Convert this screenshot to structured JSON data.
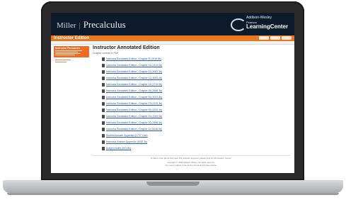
{
  "header": {
    "title_main": "Miller",
    "title_sub": "Precalculus",
    "logo_top": "Addison-Wesley",
    "logo_mid": "Pearson",
    "logo_main": "LearningCenter"
  },
  "band": {
    "title": "Instructor Edition"
  },
  "sidebar": {
    "heading": "Instructor Resources"
  },
  "main": {
    "title": "Instructor Annotated Edition",
    "subtitle": "Chapter content in PDF",
    "items": [
      {
        "label": "Instructor Annotated Edition - Chapter R (1919.5k)"
      },
      {
        "label": "Instructor Annotated Edition - Chapter 01 (2419.0k)"
      },
      {
        "label": "Instructor Annotated Edition - Chapter 02 (3087.3k)"
      },
      {
        "label": "Instructor Annotated Edition - Chapter 03 (3092.0k)"
      },
      {
        "label": "Instructor Annotated Edition - Chapter 04 (2719.9k)"
      },
      {
        "label": "Instructor Annotated Edition - Chapter 05 (2668.3k)"
      },
      {
        "label": "Instructor Annotated Edition - Chapter 06 (3037.8k)"
      },
      {
        "label": "Instructor Annotated Edition - Chapter 07 (2133.3k)"
      },
      {
        "label": "Instructor Annotated Edition - Chapter 08 (4243.3k)"
      },
      {
        "label": "Instructor Annotated Edition - Chapter 09 (2040.0k)"
      },
      {
        "label": "Instructor Annotated Edition - Chapter 10 (2696.4k)"
      },
      {
        "label": "Instructor Annotated Edition - Chapter 11 (3046.5k)"
      },
      {
        "label": "Student Answer Appendix (1737.5 kb)"
      },
      {
        "label": "Instructor Answer Appendix (4832.3k)"
      },
      {
        "label": "Subject Index (647.8k)"
      }
    ]
  },
  "footer": {
    "note": "To learn more about the book this website supports, please visit its Information Center.",
    "copyright_1": "Copyright © 2009 Addison-Wesley. All rights reserved.",
    "copyright_2": "Any use is subject to the Terms of Use and Privacy Notice."
  },
  "colors": {
    "header_bg": "#0d1a2c",
    "accent_orange": "#e87722",
    "link_blue": "#2b5aa8"
  }
}
